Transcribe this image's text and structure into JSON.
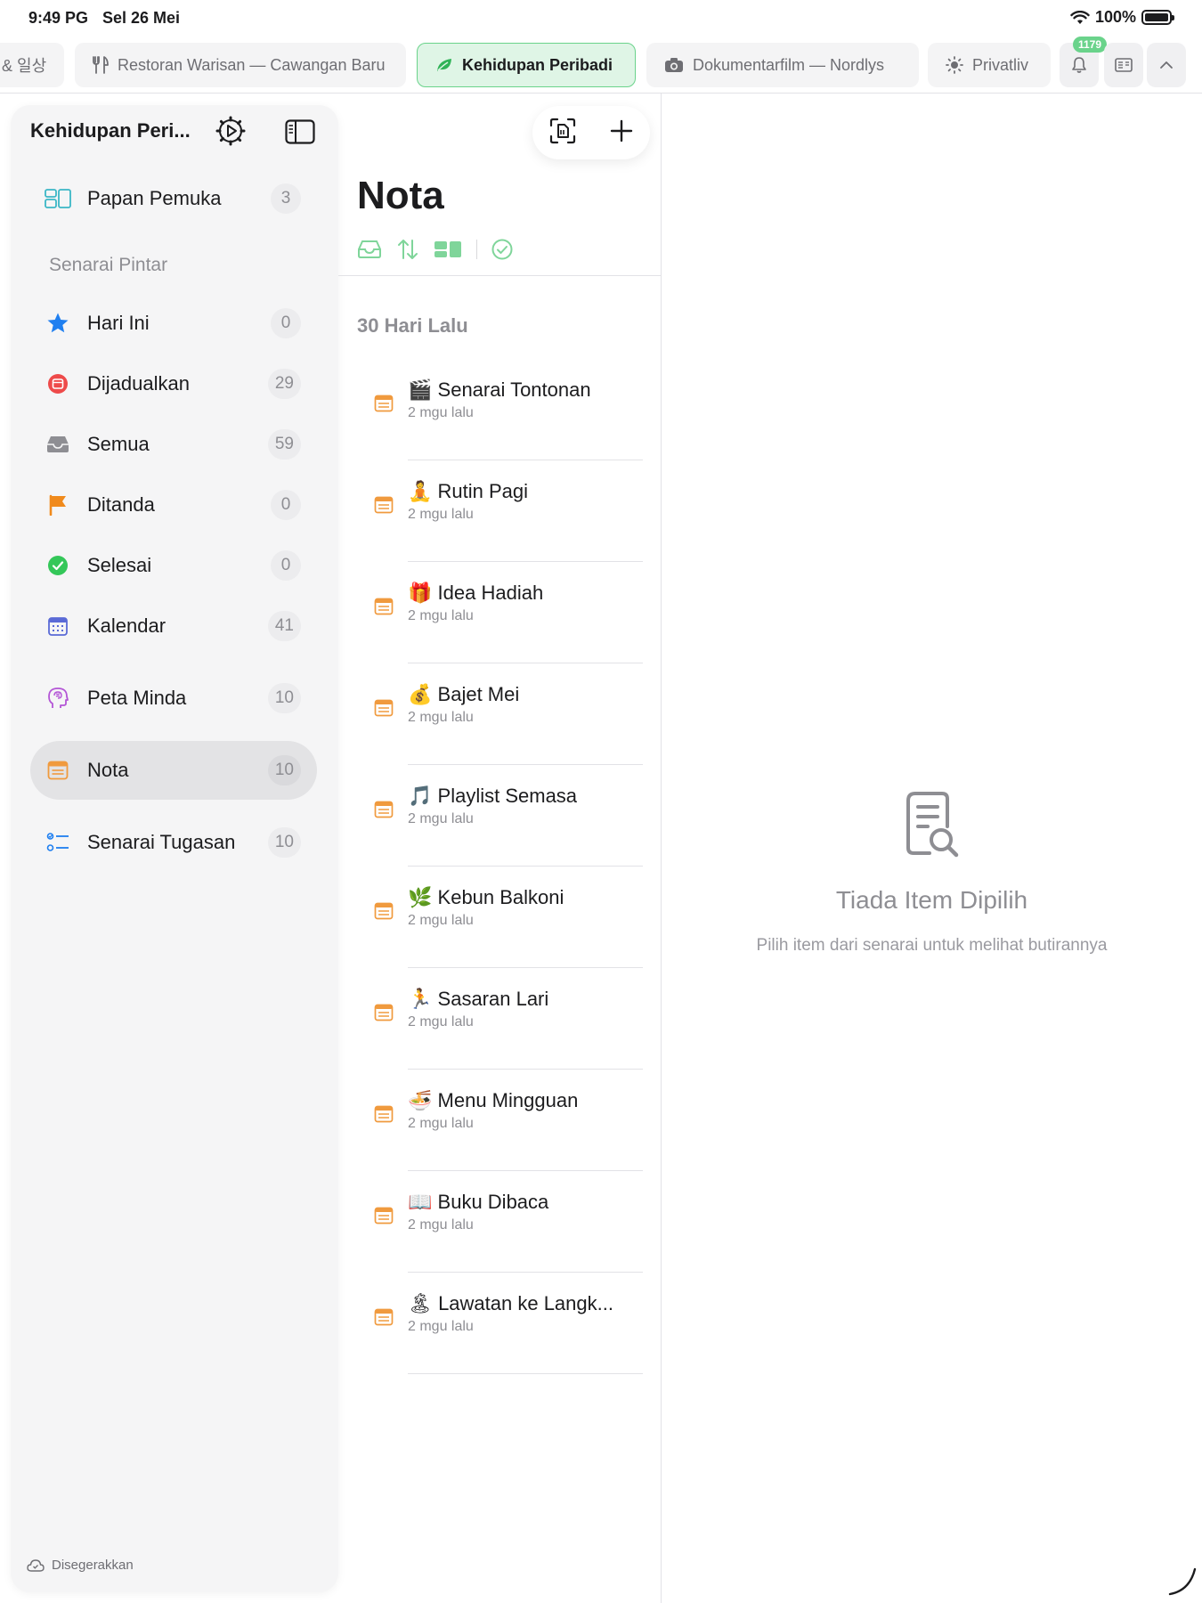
{
  "status": {
    "time": "9:49 PG",
    "date": "Sel 26 Mei",
    "battery": "100%"
  },
  "tabs": [
    {
      "label": "& 일상",
      "icon": "none"
    },
    {
      "label": "Restoran Warisan — Cawangan Baru",
      "icon": "fork-knife-icon"
    },
    {
      "label": "Kehidupan Peribadi",
      "icon": "leaf-icon",
      "active": true
    },
    {
      "label": "Dokumentarfilm — Nordlys",
      "icon": "camera-icon"
    },
    {
      "label": "Privatliv",
      "icon": "sun-icon"
    }
  ],
  "notif_badge": "1179",
  "sidebar": {
    "title": "Kehidupan Peri...",
    "dashboard": {
      "label": "Papan Pemuka",
      "count": "3"
    },
    "section_label": "Senarai Pintar",
    "items": [
      {
        "label": "Hari Ini",
        "count": "0"
      },
      {
        "label": "Dijadualkan",
        "count": "29"
      },
      {
        "label": "Semua",
        "count": "59"
      },
      {
        "label": "Ditanda",
        "count": "0"
      },
      {
        "label": "Selesai",
        "count": "0"
      },
      {
        "label": "Kalendar",
        "count": "41"
      },
      {
        "label": "Peta Minda",
        "count": "10"
      },
      {
        "label": "Nota",
        "count": "10"
      },
      {
        "label": "Senarai Tugasan",
        "count": "10"
      }
    ],
    "sync_label": "Disegerakkan"
  },
  "list": {
    "title": "Nota",
    "group": "30 Hari Lalu",
    "notes": [
      {
        "emoji": "🎬",
        "title": "Senarai Tontonan",
        "time": "2 mgu lalu"
      },
      {
        "emoji": "🧘",
        "title": "Rutin Pagi",
        "time": "2 mgu lalu"
      },
      {
        "emoji": "🎁",
        "title": "Idea Hadiah",
        "time": "2 mgu lalu"
      },
      {
        "emoji": "💰",
        "title": "Bajet Mei",
        "time": "2 mgu lalu"
      },
      {
        "emoji": "🎵",
        "title": "Playlist Semasa",
        "time": "2 mgu lalu"
      },
      {
        "emoji": "🌿",
        "title": "Kebun Balkoni",
        "time": "2 mgu lalu"
      },
      {
        "emoji": "🏃",
        "title": "Sasaran Lari",
        "time": "2 mgu lalu"
      },
      {
        "emoji": "🍜",
        "title": "Menu Mingguan",
        "time": "2 mgu lalu"
      },
      {
        "emoji": "📖",
        "title": "Buku Dibaca",
        "time": "2 mgu lalu"
      },
      {
        "emoji": "🏝",
        "title": "Lawatan ke Langk...",
        "time": "2 mgu lalu"
      }
    ]
  },
  "detail": {
    "empty_title": "Tiada Item Dipilih",
    "empty_subtitle": "Pilih item dari senarai untuk melihat butirannya"
  },
  "colors": {
    "accent_green": "#6ad38b",
    "note_orange": "#f09a3e"
  }
}
